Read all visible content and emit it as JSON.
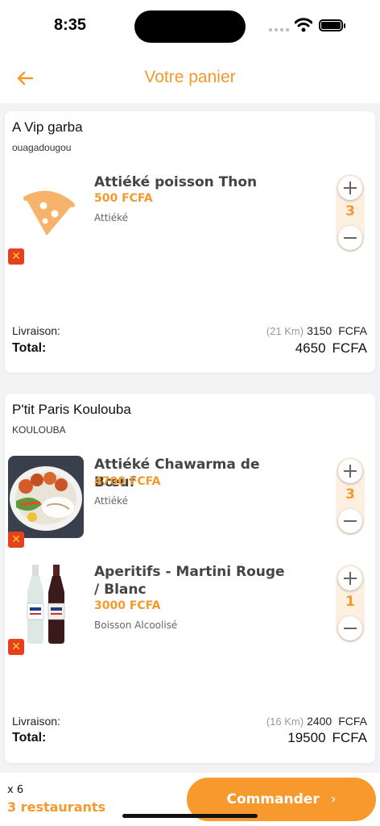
{
  "status": {
    "time": "8:35"
  },
  "header": {
    "title": "Votre panier"
  },
  "carts": [
    {
      "restaurant": "A Vip garba",
      "city": "ouagadougou",
      "items": [
        {
          "name": "Attiéké poisson Thon",
          "price": "500 FCFA",
          "category": "Attiéké",
          "quantity": "3",
          "image": "pizza-icon"
        }
      ],
      "delivery_label": "Livraison:",
      "distance": "(21 Km)",
      "delivery_amount": "3150",
      "currency": "FCFA",
      "total_label": "Total:",
      "total_amount": "4650"
    },
    {
      "restaurant": "P'tit Paris Koulouba",
      "city": "KOULOUBA",
      "items": [
        {
          "name": "Attiéké Chawarma de Bœuf",
          "price": "4700 FCFA",
          "category": "Attiéké",
          "quantity": "3",
          "image": "food-plate-image"
        },
        {
          "name": "Aperitifs - Martini Rouge / Blanc",
          "price": "3000 FCFA",
          "category": "Boisson Alcoolisé",
          "quantity": "1",
          "image": "martini-bottles-image"
        }
      ],
      "delivery_label": "Livraison:",
      "distance": "(16 Km)",
      "delivery_amount": "2400",
      "currency": "FCFA",
      "total_label": "Total:",
      "total_amount": "19500"
    }
  ],
  "footer": {
    "count": "x 6",
    "restaurants": "3 restaurants",
    "order_label": "Commander"
  },
  "colors": {
    "accent": "#f39a2c",
    "remove": "#e8401e"
  }
}
